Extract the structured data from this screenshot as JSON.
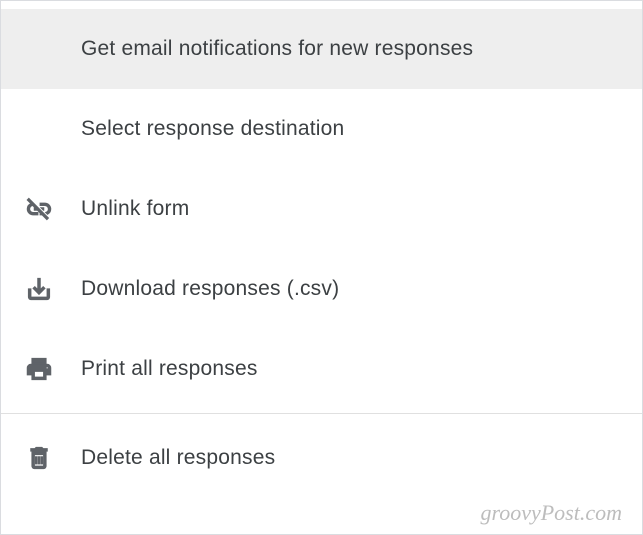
{
  "menu": {
    "items": [
      {
        "label": "Get email notifications for new responses",
        "highlighted": true,
        "icon": null
      },
      {
        "label": "Select response destination",
        "highlighted": false,
        "icon": null
      },
      {
        "label": "Unlink form",
        "highlighted": false,
        "icon": "unlink"
      },
      {
        "label": "Download responses (.csv)",
        "highlighted": false,
        "icon": "download"
      },
      {
        "label": "Print all responses",
        "highlighted": false,
        "icon": "print"
      }
    ],
    "afterDivider": [
      {
        "label": "Delete all responses",
        "highlighted": false,
        "icon": "delete"
      }
    ]
  },
  "watermark": "groovyPost.com"
}
